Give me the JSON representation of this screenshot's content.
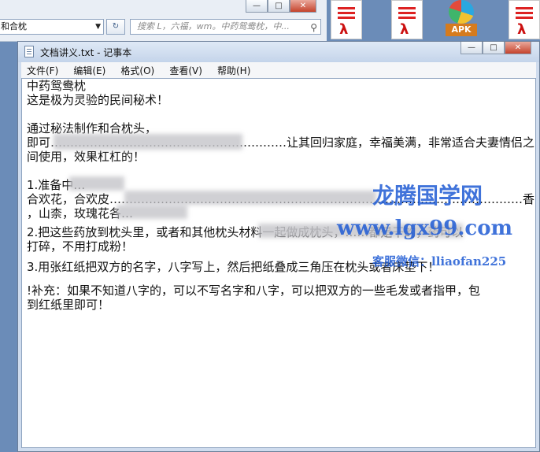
{
  "background_window": {
    "path_text": "和合枕",
    "search_placeholder": "搜索 L，六福，wm。中药鸳鸯枕，中..."
  },
  "notepad": {
    "title": "文档讲义.txt - 记事本",
    "menus": [
      "文件(F)",
      "编辑(E)",
      "格式(O)",
      "查看(V)",
      "帮助(H)"
    ],
    "lines": [
      "中药鸳鸯枕",
      "这是极为灵验的民间秘术！",
      "",
      "通过秘法制作和合枕头，",
      "即可……………………………………………………让其回归家庭，幸福美满，非常适合夫妻情侣之",
      "间使用，效果杠杠的！",
      "",
      "1.准备中…",
      "合欢花，合欢皮……………………………………………………………………………………………香",
      "，山柰，玫瑰花各…",
      "2.把这些药放到枕头里，或者和其他枕头材料一起做成枕头，……都是干的，药可以",
      "打碎，不用打成粉！",
      "",
      "3.用张红纸把双方的名字，八字写上，然后把纸叠成三角压在枕头或者床垫下！",
      "",
      "!补充：如果不知道八字的，可以不写名字和八字，可以把双方的一些毛发或者指甲，包",
      "到红纸里即可！"
    ]
  },
  "watermark": {
    "brand": "龙腾国学网",
    "url": "www.lgx99.com",
    "wechat": "客服微信：lliaofan225"
  },
  "desktop": {
    "apk_label": "APK"
  },
  "colors": {
    "watermark_blue": "#1f5bd4",
    "titlebar": "#cfdcee",
    "close_red": "#c5432c"
  }
}
